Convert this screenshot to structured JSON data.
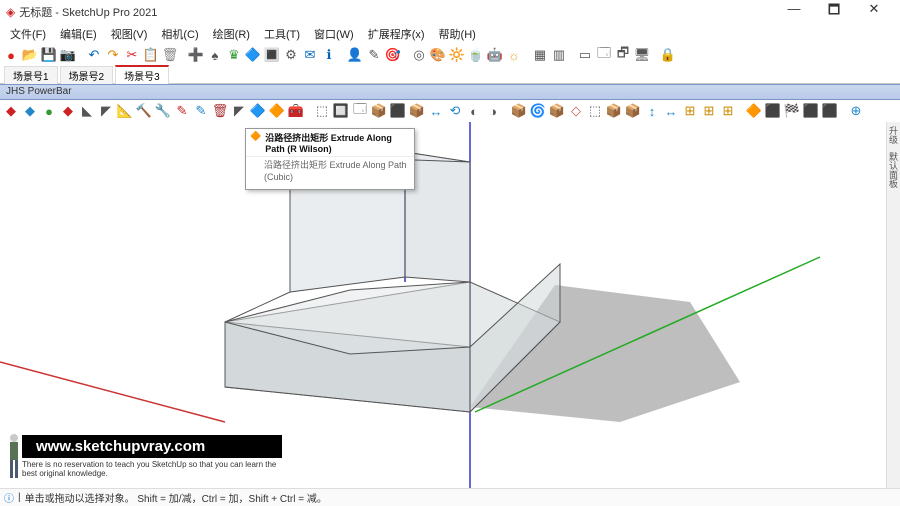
{
  "window": {
    "title": "无标题 - SketchUp Pro 2021",
    "min": "—",
    "max": "🗖",
    "close": "✕"
  },
  "menu": [
    "文件(F)",
    "编辑(E)",
    "视图(V)",
    "相机(C)",
    "绘图(R)",
    "工具(T)",
    "窗口(W)",
    "扩展程序(x)",
    "帮助(H)"
  ],
  "scenes": [
    "场景号1",
    "场景号2",
    "场景号3"
  ],
  "powerbar_label": "JHS PowerBar",
  "tooltip": {
    "title": "沿路径挤出矩形 Extrude Along Path (R Wilson)",
    "body": "沿路径挤出矩形 Extrude Along Path (Cubic)"
  },
  "sidetabs": [
    "升级",
    "默认面板"
  ],
  "status": {
    "hint": "单击或拖动以选择对象。 Shift = 加/减，Ctrl = 加，Shift + Ctrl = 减。"
  },
  "watermark": {
    "url": "www.sketchupvray.com",
    "sub": "There is no reservation to teach you SketchUp so that you can learn the best original knowledge."
  },
  "tb1": [
    "●",
    "📂",
    "💾",
    "📷",
    "",
    "↶",
    "↷",
    "✂",
    "📋",
    "🗑",
    "",
    "➕",
    "♠",
    "♛",
    "🔷",
    "🔳",
    "⚙",
    "✉",
    "ℹ",
    "",
    "👤",
    "✎",
    "🎯",
    "",
    "◎",
    "🎨",
    "🔆",
    "🍵",
    "🤖",
    "☼",
    "",
    "▦",
    "▥",
    "",
    "▭",
    "🗔",
    "🗗",
    "🖥",
    "",
    "🔒"
  ],
  "pb": [
    "◆",
    "◆",
    "●",
    "◆",
    "◣",
    "◤",
    "📐",
    "🔨",
    "🔧",
    "✎",
    "✎",
    "🗑",
    "◤",
    "🔷",
    "🔶",
    "🧰",
    "",
    "⬚",
    "🔲",
    "🗔",
    "📦",
    "⬛",
    "📦",
    "↔",
    "⟲",
    "◐",
    "◑",
    "",
    "📦",
    "🌀",
    "📦",
    "◇",
    "⬚",
    "📦",
    "📦",
    "↕",
    "↔",
    "⊞",
    "⊞",
    "⊞",
    "",
    "🔶",
    "⬛",
    "🏁",
    "⬛",
    "⬛",
    "",
    "⊕"
  ]
}
